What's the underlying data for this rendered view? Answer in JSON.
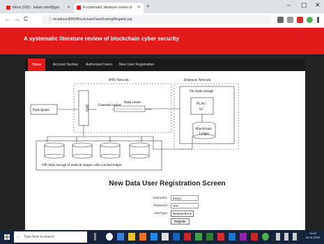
{
  "browser": {
    "tabs": [
      {
        "label": "Inbox (182) - kalam.smrit@gm"
      },
      {
        "label": "A systematic literature review of"
      }
    ],
    "new_tab": "+",
    "window_controls": [
      "–",
      "▢",
      "✕"
    ],
    "url": "localhost:8080/BlockchainDataSharing/Register.jsp",
    "nav": [
      "←",
      "→",
      "C"
    ]
  },
  "app": {
    "title": "A systematic literature review of blockchain cyber security",
    "nav": [
      {
        "label": "Home"
      },
      {
        "label": "Account Section"
      },
      {
        "label": "Authorized Users"
      },
      {
        "label": "New User Registration"
      }
    ]
  },
  "diagram": {
    "ipfs_label": "IPFS Network",
    "eth_label": "Ethereum Network",
    "participants": "Participants",
    "ipfs_box": "IPFS",
    "generate_hashes": "Generate hashes",
    "hash_values": "Hash values",
    "hash_string": "****************",
    "onchain": "On-chain storage",
    "pcac": "PCAC-",
    "sc": "SC",
    "blockchain": "Blockchain",
    "ledger": "Ledger",
    "offchain": "Off-chain storage of medical images with synched ledger"
  },
  "form": {
    "title": "New Data User Registration Screen",
    "username_label": "Username",
    "username_value": "kavya",
    "password_label": "Password",
    "password_value": "•••••",
    "usertype_label": "UserType",
    "usertype_value": "Researcher ▾",
    "register_label": "Register"
  },
  "taskbar": {
    "search_placeholder": "Type here to search",
    "time": "11:04",
    "date": "22-11-2020"
  },
  "colors": {
    "accent": "#e11b1b",
    "dark": "#232323",
    "taskbar": "#16233a"
  }
}
